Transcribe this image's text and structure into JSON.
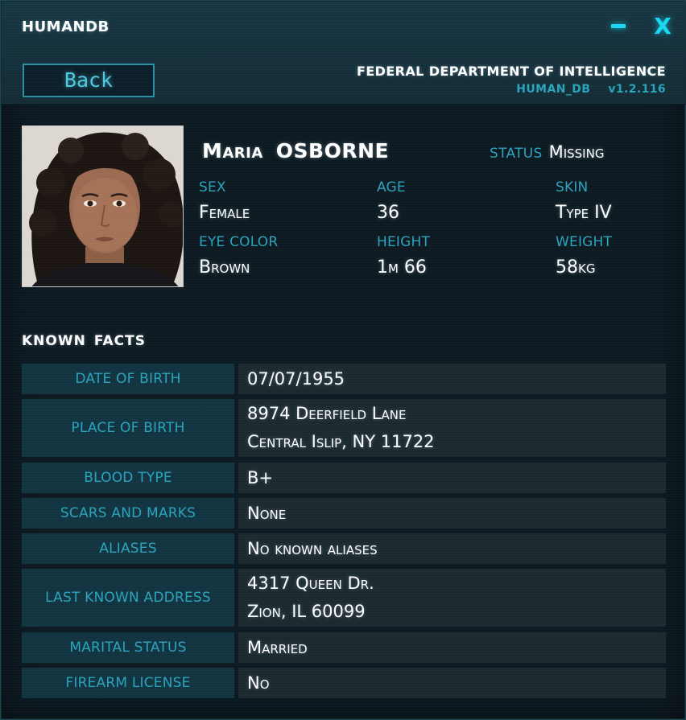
{
  "app": {
    "title": "HUMANDB",
    "minimize_glyph": "–",
    "close_glyph": "X",
    "accent_color": "#19d6f2"
  },
  "header": {
    "back_label": "Back",
    "agency": "FEDERAL DEPARTMENT OF INTELLIGENCE",
    "db_name": "HUMAN_DB",
    "version": "v1.2.116"
  },
  "profile": {
    "first_name": "Maria",
    "last_name": "OSBORNE",
    "status_label": "STATUS",
    "status_value": "Missing",
    "attributes": [
      {
        "label": "SEX",
        "value": "Female"
      },
      {
        "label": "AGE",
        "value": "36"
      },
      {
        "label": "SKIN",
        "value": "Type IV"
      },
      {
        "label": "EYE COLOR",
        "value": "Brown"
      },
      {
        "label": "HEIGHT",
        "value": "1m 66"
      },
      {
        "label": "WEIGHT",
        "value": "58kg"
      }
    ]
  },
  "facts": {
    "title_word1": "KNOWN",
    "title_word2": "FACTS",
    "rows": [
      {
        "label": "DATE OF BIRTH",
        "lines": [
          "07/07/1955"
        ]
      },
      {
        "label": "PLACE OF BIRTH",
        "lines": [
          "8974 Deerfield Lane",
          "Central Islip, NY 11722"
        ]
      },
      {
        "label": "BLOOD TYPE",
        "lines": [
          "B+"
        ]
      },
      {
        "label": "SCARS AND MARKS",
        "lines": [
          "None"
        ]
      },
      {
        "label": "ALIASES",
        "lines": [
          "No known aliases"
        ]
      },
      {
        "label": "LAST KNOWN ADDRESS",
        "lines": [
          "4317 Queen  Dr.",
          "Zion, IL 60099"
        ]
      },
      {
        "label": "MARITAL STATUS",
        "lines": [
          "Married"
        ]
      },
      {
        "label": "FIREARM LICENSE",
        "lines": [
          "No"
        ]
      }
    ]
  }
}
